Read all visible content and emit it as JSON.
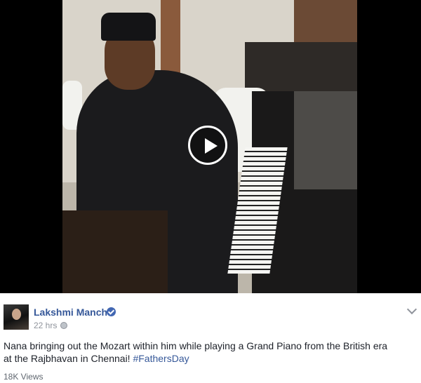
{
  "post": {
    "author": "Lakshmi Manchu",
    "time": "22 hrs",
    "separator": "·",
    "text_before_hashtag": "Nana bringing out the Mozart within him while playing a Grand Piano from the British era at the Rajbhavan in Chennai! ",
    "hashtag": "#FathersDay",
    "views": "18K Views"
  },
  "icons": {
    "play": "play-icon",
    "verified": "verified-badge-icon",
    "audience": "globe-icon",
    "options": "chevron-down-icon"
  },
  "colors": {
    "link": "#365899",
    "meta": "#90949c",
    "text": "#1d2129",
    "verified": "#4267b2"
  }
}
